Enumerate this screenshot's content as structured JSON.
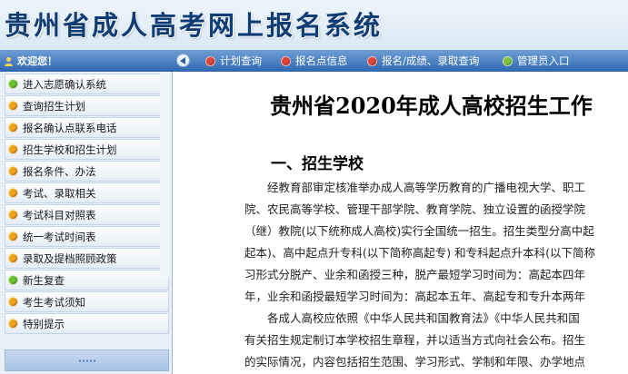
{
  "banner": {
    "title": "贵州省成人高考网上报名系统"
  },
  "topbar": {
    "welcome": "欢迎您！",
    "nav": [
      {
        "label": "计划查询",
        "color": "#e0433a"
      },
      {
        "label": "报名点信息",
        "color": "#e0433a"
      },
      {
        "label": "报名/成绩、录取查询",
        "color": "#e0433a"
      },
      {
        "label": "管理员入口",
        "color": "#7ec23a"
      }
    ]
  },
  "sidebar": {
    "items": [
      {
        "label": "进入志愿确认系统",
        "color": "#6cbf2e"
      },
      {
        "label": "查询招生计划",
        "color": "#f0a21b"
      },
      {
        "label": "报名确认点联系电话",
        "color": "#f0a21b"
      },
      {
        "label": "招生学校和招生计划",
        "color": "#f0a21b"
      },
      {
        "label": "报名条件、办法",
        "color": "#f0a21b"
      },
      {
        "label": "考试、录取相关",
        "color": "#f0a21b"
      },
      {
        "label": "考试科目对照表",
        "color": "#f0a21b"
      },
      {
        "label": "统一考试时间表",
        "color": "#f0a21b"
      },
      {
        "label": "录取及提档照顾政策",
        "color": "#f0a21b"
      },
      {
        "label": "新生复查",
        "color": "#6cbf2e"
      },
      {
        "label": "考生考试须知",
        "color": "#f0a21b"
      },
      {
        "label": "特别提示",
        "color": "#f0a21b"
      }
    ]
  },
  "content": {
    "title": "贵州省2020年成人高校招生工作",
    "section_heading": "一、招生学校",
    "lines": [
      "经教育部审定核准举办成人高等学历教育的广播电视大学、职工",
      "院、农民高等学校、管理干部学院、教育学院、独立设置的函授学院",
      "（继）教院(以下统称成人高校)实行全国统一招生。招生类型分高中起",
      "起本)、高中起点升专科(以下简称高起专) 和专科起点升本科(以下简称",
      "习形式分脱产、业余和函授三种，脱产最短学习时间为：高起本四年",
      "年，业余和函授最短学习时间为：高起本五年、高起专和专升本两年",
      "各成人高校应依照《中华人民共和国教育法》《中华人民共和国",
      "有关招生规定制订本学校招生章程，并以适当方式向社会公布。招生",
      "的实际情况，内容包括招生范围、学习形式、学制和年限、办学地点"
    ]
  }
}
